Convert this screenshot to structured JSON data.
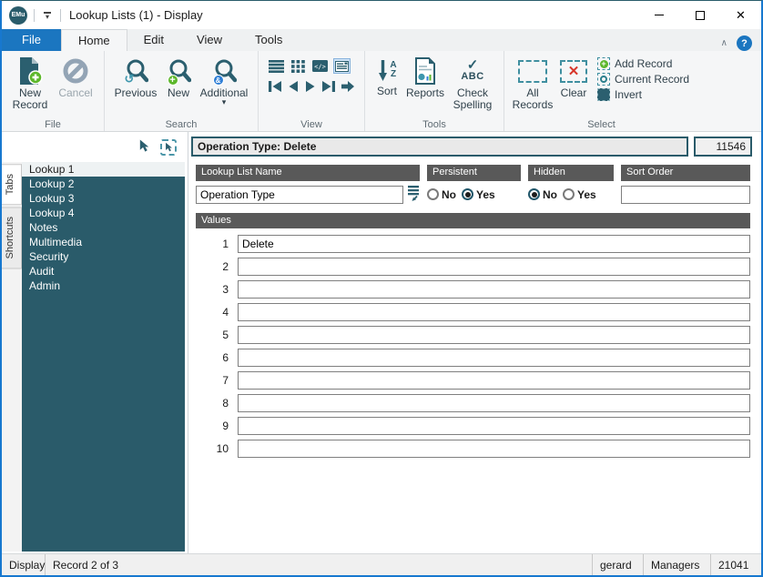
{
  "window": {
    "title": "Lookup Lists (1) - Display",
    "logo": "EMu"
  },
  "icons": {
    "close": "✕",
    "help": "?",
    "collapse_ribbon": "∧",
    "dropdown_caret": "▾",
    "previous_badge": "↺",
    "new_badge": "+",
    "additional_badge": "&",
    "check": "✓",
    "abc": "ABC",
    "sort_a": "A",
    "sort_z": "Z",
    "clear_x": "✕",
    "add_plus": "+"
  },
  "ribbon": {
    "tabs": [
      "File",
      "Home",
      "Edit",
      "View",
      "Tools"
    ],
    "groups": {
      "file": {
        "label": "File",
        "new_record": "New Record",
        "cancel": "Cancel"
      },
      "search": {
        "label": "Search",
        "previous": "Previous",
        "new": "New",
        "additional": "Additional"
      },
      "view": {
        "label": "View"
      },
      "tools": {
        "label": "Tools",
        "sort": "Sort",
        "reports": "Reports",
        "check_spelling": "Check Spelling"
      },
      "select": {
        "label": "Select",
        "all_records": "All Records",
        "clear": "Clear",
        "add_record": "Add Record",
        "current_record": "Current Record",
        "invert": "Invert"
      }
    }
  },
  "sidebar": {
    "tabs": [
      {
        "label": "Tabs"
      },
      {
        "label": "Shortcuts"
      }
    ],
    "items": [
      {
        "label": "Lookup 1",
        "selected": true
      },
      {
        "label": "Lookup 2"
      },
      {
        "label": "Lookup 3"
      },
      {
        "label": "Lookup 4"
      },
      {
        "label": "Notes"
      },
      {
        "label": "Multimedia"
      },
      {
        "label": "Security"
      },
      {
        "label": "Audit"
      },
      {
        "label": "Admin"
      }
    ]
  },
  "record": {
    "header": "Operation Type: Delete",
    "number": "11546"
  },
  "form": {
    "lookup_list_name": {
      "label": "Lookup List Name",
      "value": "Operation Type"
    },
    "persistent": {
      "label": "Persistent",
      "no": "No",
      "yes": "Yes",
      "selected": "Yes"
    },
    "hidden": {
      "label": "Hidden",
      "no": "No",
      "yes": "Yes",
      "selected": "No"
    },
    "sort_order": {
      "label": "Sort Order",
      "value": ""
    }
  },
  "values": {
    "label": "Values",
    "rows": [
      {
        "num": "1",
        "value": "Delete"
      },
      {
        "num": "2",
        "value": ""
      },
      {
        "num": "3",
        "value": ""
      },
      {
        "num": "4",
        "value": ""
      },
      {
        "num": "5",
        "value": ""
      },
      {
        "num": "6",
        "value": ""
      },
      {
        "num": "7",
        "value": ""
      },
      {
        "num": "8",
        "value": ""
      },
      {
        "num": "9",
        "value": ""
      },
      {
        "num": "10",
        "value": ""
      }
    ]
  },
  "status_bar": {
    "mode": "Display",
    "record": "Record 2 of 3",
    "user": "gerard",
    "group": "Managers",
    "code": "21041"
  },
  "colors": {
    "accent_blue": "#1b76c0",
    "teal": "#2b5f6f",
    "sidebar_teal": "#2a5b6a",
    "header_gray": "#595959",
    "green": "#5cb72b",
    "red": "#d8352a"
  }
}
